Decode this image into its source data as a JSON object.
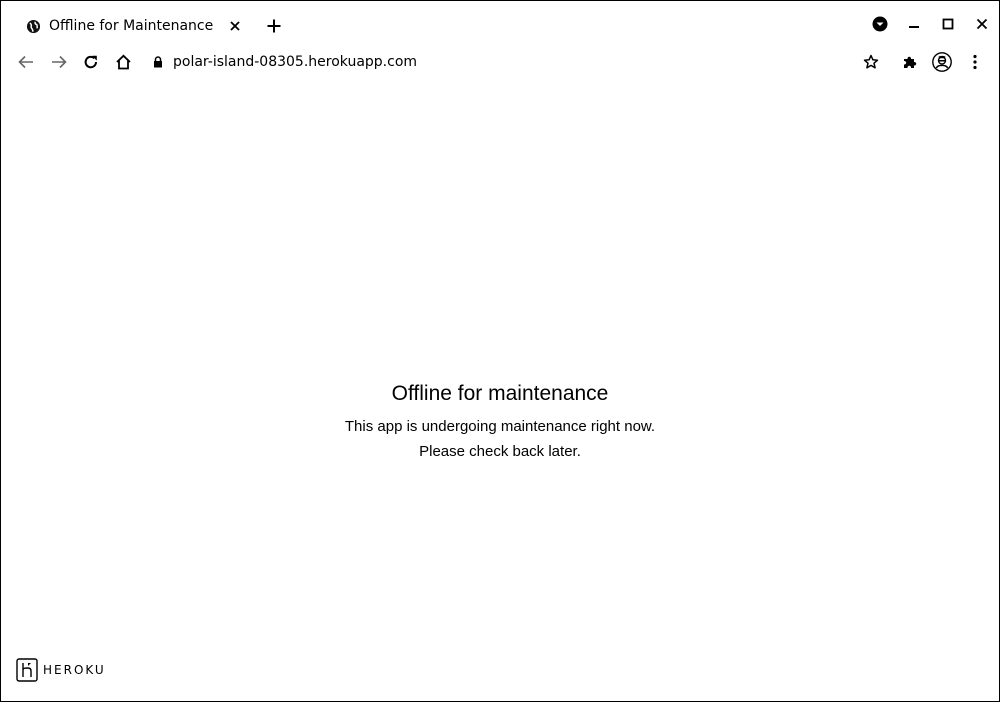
{
  "browser": {
    "tab": {
      "title": "Offline for Maintenance",
      "favicon": "globe-icon"
    },
    "omnibox": {
      "url": "polar-island-08305.herokuapp.com",
      "security_icon": "lock-icon"
    },
    "toolbar_icons": [
      "back-icon",
      "forward-icon",
      "reload-icon",
      "home-icon",
      "star-icon",
      "extensions-icon",
      "profile-icon",
      "menu-icon"
    ],
    "window_controls": [
      "minimize-icon",
      "maximize-icon",
      "close-icon"
    ]
  },
  "page": {
    "heading": "Offline for maintenance",
    "line1": "This app is undergoing maintenance right now.",
    "line2": "Please check back later.",
    "logo_text": "HEROKU"
  }
}
